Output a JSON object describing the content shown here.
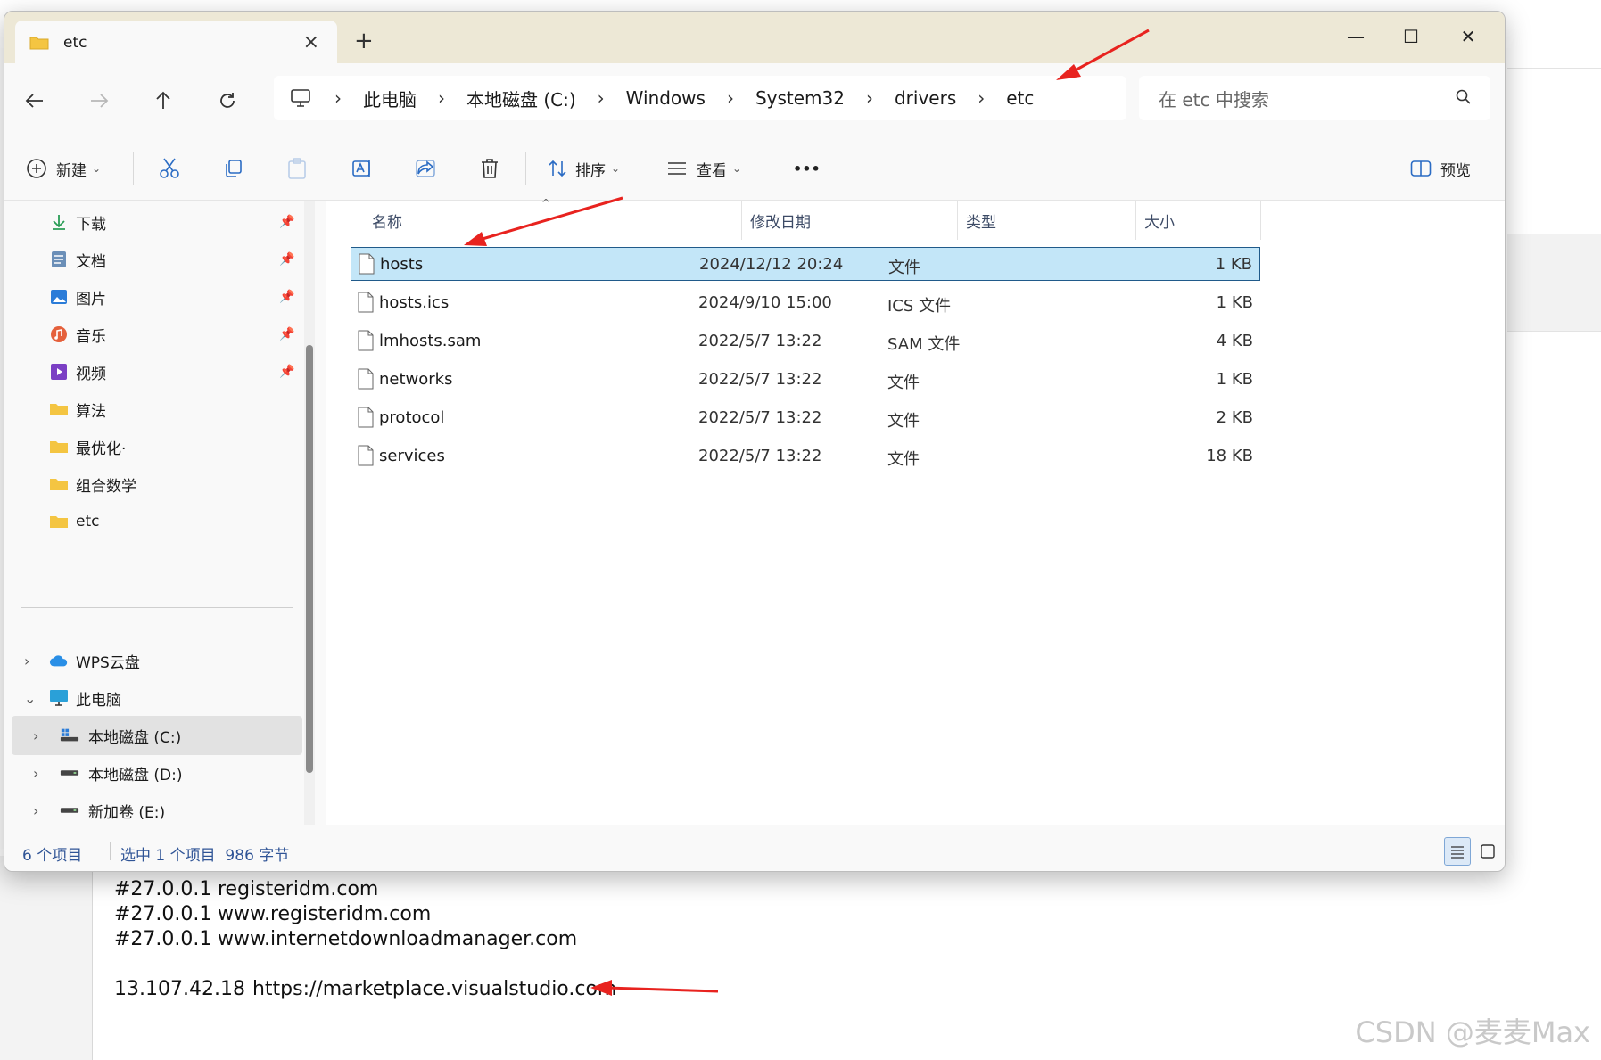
{
  "window": {
    "tab_title": "etc",
    "new_tab": "+",
    "minimize": "—",
    "maximize": "☐",
    "close": "✕"
  },
  "address": {
    "crumbs": [
      "此电脑",
      "本地磁盘 (C:)",
      "Windows",
      "System32",
      "drivers",
      "etc"
    ],
    "separator": "›",
    "search_placeholder": "在 etc 中搜索"
  },
  "toolbar": {
    "new_label": "新建",
    "sort_label": "排序",
    "view_label": "查看",
    "more_label": "•••",
    "preview_label": "预览"
  },
  "sidebar": {
    "quick": [
      {
        "label": "下载",
        "icon": "download-icon"
      },
      {
        "label": "文档",
        "icon": "document-icon"
      },
      {
        "label": "图片",
        "icon": "pictures-icon"
      },
      {
        "label": "音乐",
        "icon": "music-icon"
      },
      {
        "label": "视频",
        "icon": "video-icon"
      },
      {
        "label": "算法",
        "icon": "folder-icon"
      },
      {
        "label": "最优化·",
        "icon": "folder-icon"
      },
      {
        "label": "组合数学",
        "icon": "folder-icon"
      },
      {
        "label": "etc",
        "icon": "folder-icon"
      }
    ],
    "tree": [
      {
        "label": "WPS云盘",
        "icon": "cloud-icon"
      },
      {
        "label": "此电脑",
        "icon": "pc-icon"
      },
      {
        "label": "本地磁盘 (C:)",
        "icon": "drive-c-icon"
      },
      {
        "label": "本地磁盘 (D:)",
        "icon": "drive-icon"
      },
      {
        "label": "新加卷 (E:)",
        "icon": "drive-icon"
      }
    ]
  },
  "columns": {
    "name": "名称",
    "date": "修改日期",
    "type": "类型",
    "size": "大小"
  },
  "files": [
    {
      "name": "hosts",
      "date": "2024/12/12 20:24",
      "type": "文件",
      "size": "1 KB"
    },
    {
      "name": "hosts.ics",
      "date": "2024/9/10 15:00",
      "type": "ICS 文件",
      "size": "1 KB"
    },
    {
      "name": "lmhosts.sam",
      "date": "2022/5/7 13:22",
      "type": "SAM 文件",
      "size": "4 KB"
    },
    {
      "name": "networks",
      "date": "2022/5/7 13:22",
      "type": "文件",
      "size": "1 KB"
    },
    {
      "name": "protocol",
      "date": "2022/5/7 13:22",
      "type": "文件",
      "size": "2 KB"
    },
    {
      "name": "services",
      "date": "2022/5/7 13:22",
      "type": "文件",
      "size": "18 KB"
    }
  ],
  "status": {
    "count": "6 个项目",
    "selection": "选中 1 个项目  986 字节"
  },
  "hosts_file": {
    "lines": [
      {
        "ip": "#27.0.0.1",
        "host": "registeridm.com"
      },
      {
        "ip": "#27.0.0.1",
        "host": "www.registeridm.com"
      },
      {
        "ip": "#27.0.0.1",
        "host": "www.internetdownloadmanager.com"
      }
    ],
    "added_line": {
      "ip": "13.107.42.18",
      "host": "https://marketplace.visualstudio.com"
    }
  },
  "watermark": "CSDN @麦麦Max",
  "colors": {
    "selection_bg": "#c3e6f8",
    "selection_border": "#205a8a",
    "annotation_arrow": "#e8231f",
    "folder": "#f4c542"
  }
}
